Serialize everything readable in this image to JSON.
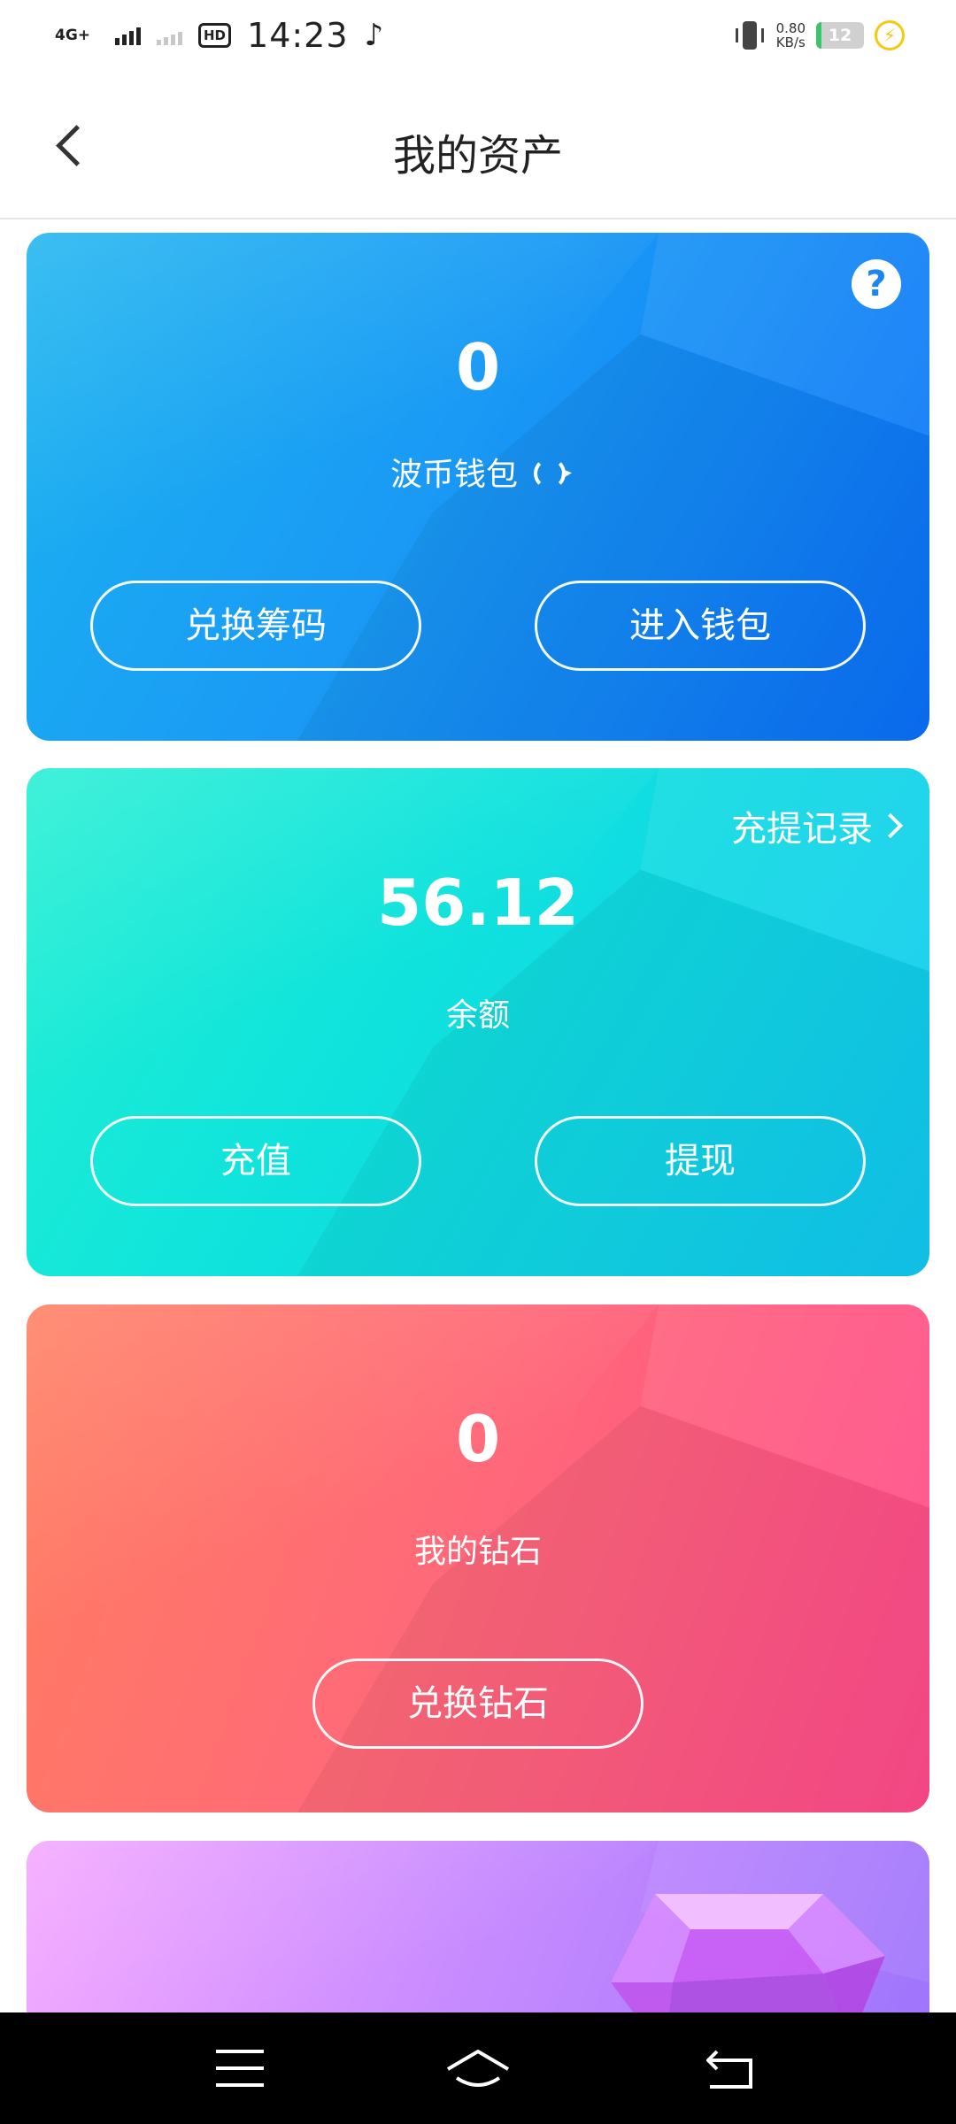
{
  "status_bar": {
    "network": "4G+",
    "hd": "HD",
    "sim": "1",
    "time": "14:23",
    "speed_value": "0.80",
    "speed_unit": "KB/s",
    "battery": "12",
    "battery_level": 0.12
  },
  "header": {
    "title": "我的资产"
  },
  "wallet_card": {
    "value": "0",
    "label": "波币钱包",
    "help_icon_text": "?",
    "buttons": {
      "exchange_chips": "兑换筹码",
      "enter_wallet": "进入钱包"
    }
  },
  "balance_card": {
    "records_link": "充提记录",
    "value": "56.12",
    "label": "余额",
    "buttons": {
      "recharge": "充值",
      "withdraw": "提现"
    }
  },
  "diamond_card": {
    "value": "0",
    "label": "我的钻石",
    "buttons": {
      "exchange_diamond": "兑换钻石"
    }
  },
  "colors": {
    "wallet_card": "#1a9af5",
    "balance_card": "#0fe3dc",
    "diamond_card": "#ff6a78",
    "purple_card": "#c98cff",
    "nav_bar": "#000000"
  },
  "icons": {
    "back": "chevron-left-icon",
    "help": "question-circle-icon",
    "refresh": "refresh-icon",
    "records": "chevron-right-icon",
    "nav_menu": "menu-icon",
    "nav_home": "home-icon",
    "nav_back": "back-icon"
  }
}
